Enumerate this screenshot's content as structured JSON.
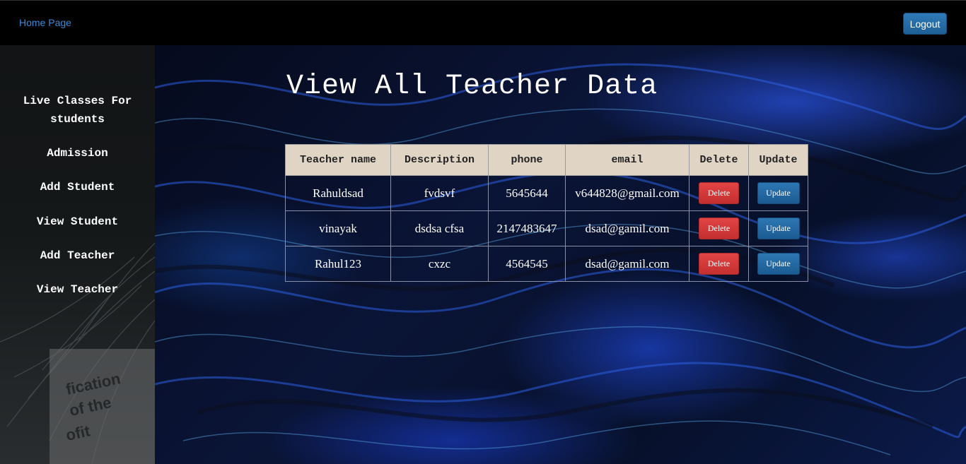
{
  "navbar": {
    "home_link": "Home Page",
    "logout_label": "Logout"
  },
  "sidebar": {
    "items": [
      {
        "label": "Live Classes For students"
      },
      {
        "label": "Admission"
      },
      {
        "label": "Add Student"
      },
      {
        "label": "View Student"
      },
      {
        "label": "Add Teacher"
      },
      {
        "label": "View Teacher"
      }
    ]
  },
  "main": {
    "title": "View All Teacher Data",
    "table": {
      "headers": [
        "Teacher name",
        "Description",
        "phone",
        "email",
        "Delete",
        "Update"
      ],
      "rows": [
        {
          "name": "Rahuldsad",
          "description": "fvdsvf",
          "phone": "5645644",
          "email": "v644828@gmail.com"
        },
        {
          "name": "vinayak",
          "description": "dsdsa cfsa",
          "phone": "2147483647",
          "email": "dsad@gamil.com"
        },
        {
          "name": "Rahul123",
          "description": "cxzc",
          "phone": "4564545",
          "email": "dsad@gamil.com"
        }
      ],
      "delete_label": "Delete",
      "update_label": "Update"
    }
  }
}
